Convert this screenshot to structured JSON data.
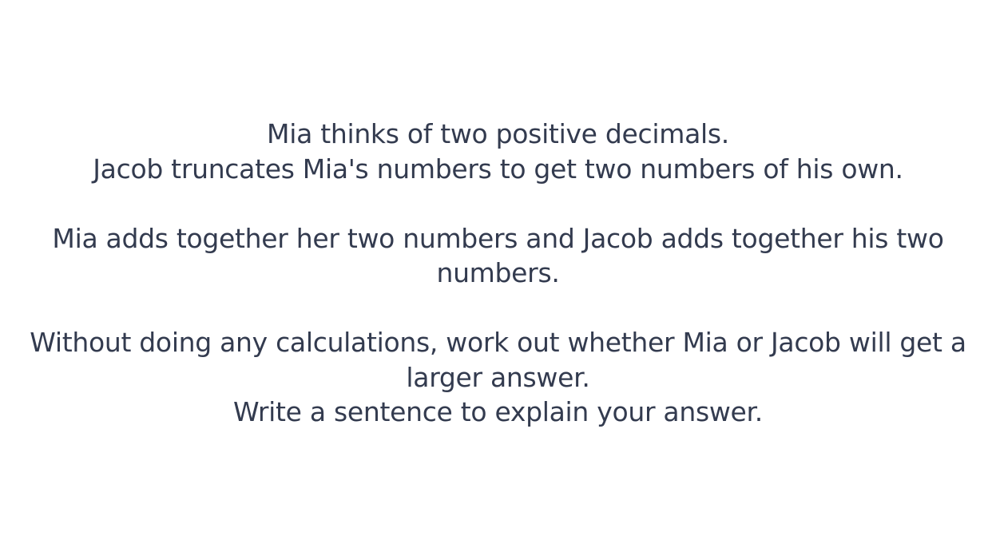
{
  "question": {
    "paragraph_1": {
      "line_1": "Mia thinks of two positive decimals.",
      "line_2": "Jacob truncates Mia's numbers to get two numbers of his own."
    },
    "paragraph_2": {
      "line_1": "Mia adds together her two numbers and Jacob adds together his two numbers."
    },
    "paragraph_3": {
      "line_1": "Without doing any calculations, work out whether Mia or Jacob will get a larger answer.",
      "line_2": "Write a sentence to explain your answer."
    }
  },
  "colors": {
    "text": "#333b4f",
    "background": "#ffffff"
  }
}
